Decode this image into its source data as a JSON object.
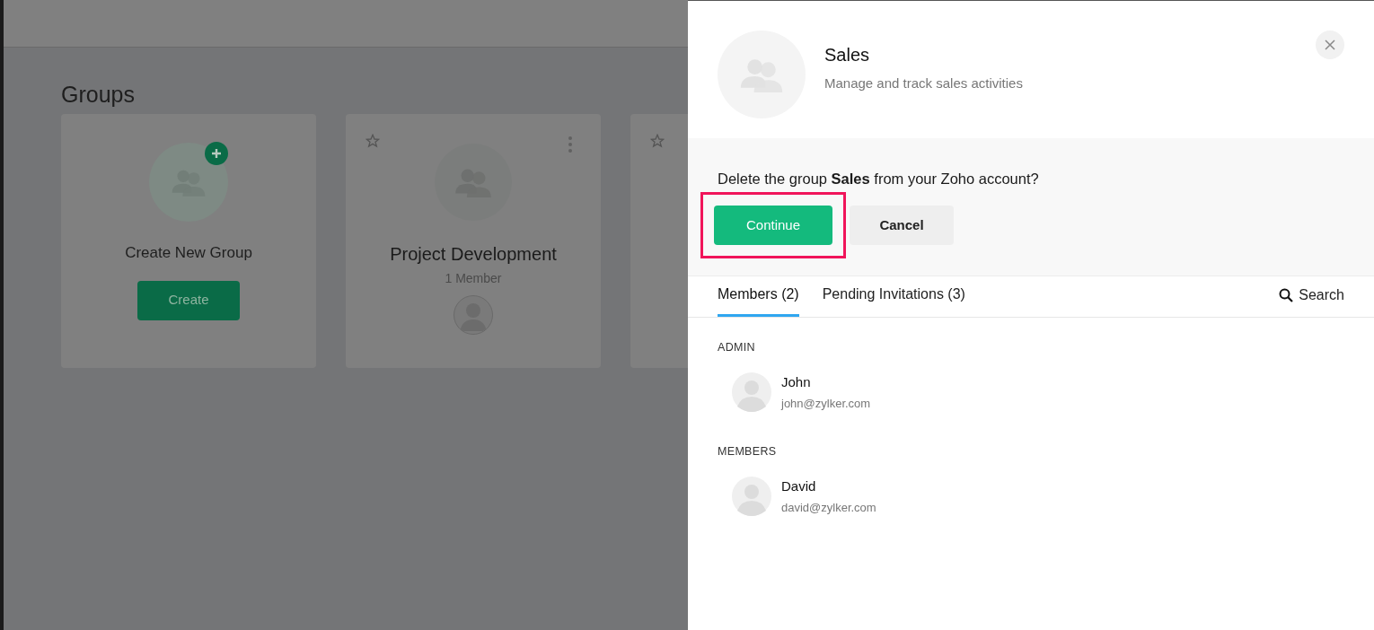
{
  "page": {
    "title": "Groups"
  },
  "cards": [
    {
      "kind": "create",
      "title": "Create New Group",
      "button": "Create"
    },
    {
      "kind": "group",
      "title": "Project Development",
      "subtitle": "1 Member"
    },
    {
      "kind": "group"
    }
  ],
  "panel": {
    "name": "Sales",
    "description": "Manage and track sales activities",
    "confirm": {
      "message": "Delete the group **Sales** from your Zoho account?",
      "buttons": [
        {
          "label": "Continue",
          "kind": "primary",
          "highlighted": true
        },
        {
          "label": "Cancel",
          "kind": "secondary",
          "highlighted": false
        }
      ]
    },
    "tabs": [
      {
        "label": "Members (2)",
        "selected": true
      },
      {
        "label": "Pending Invitations (3)",
        "selected": false
      }
    ],
    "search": "Search",
    "sections": [
      {
        "heading": "ADMIN",
        "people": [
          {
            "name": "John",
            "email": "john@zylker.com"
          }
        ]
      },
      {
        "heading": "MEMBERS",
        "people": [
          {
            "name": "David",
            "email": "david@zylker.com"
          }
        ]
      }
    ]
  }
}
